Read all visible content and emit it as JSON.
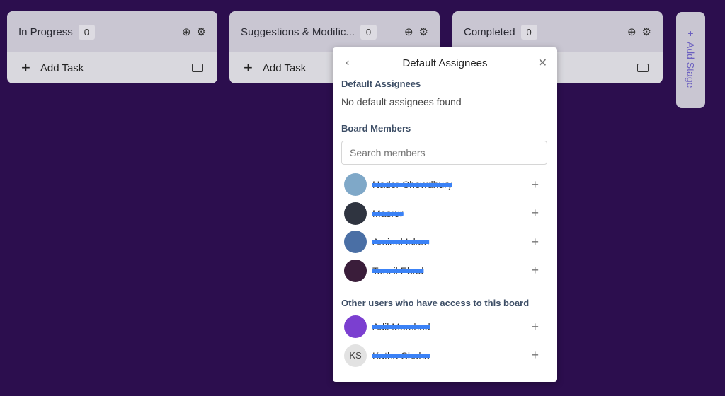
{
  "columns": [
    {
      "title": "In Progress",
      "count": "0",
      "add_task": "Add Task"
    },
    {
      "title": "Suggestions & Modific...",
      "count": "0",
      "add_task": "Add Task"
    },
    {
      "title": "Completed",
      "count": "0"
    }
  ],
  "add_stage": "Add Stage",
  "popover": {
    "title": "Default Assignees",
    "default_heading": "Default Assignees",
    "empty_text": "No default assignees found",
    "members_heading": "Board Members",
    "search_placeholder": "Search members",
    "members": [
      {
        "name": "Nader Chowdhury"
      },
      {
        "name": "Masrur"
      },
      {
        "name": "Aminul Islam"
      },
      {
        "name": "Tanzil Ebad"
      }
    ],
    "others_heading": "Other users who have access to this board",
    "others": [
      {
        "name": "Adil Morshed"
      },
      {
        "name": "Katha Shaha",
        "initials": "KS"
      }
    ]
  }
}
